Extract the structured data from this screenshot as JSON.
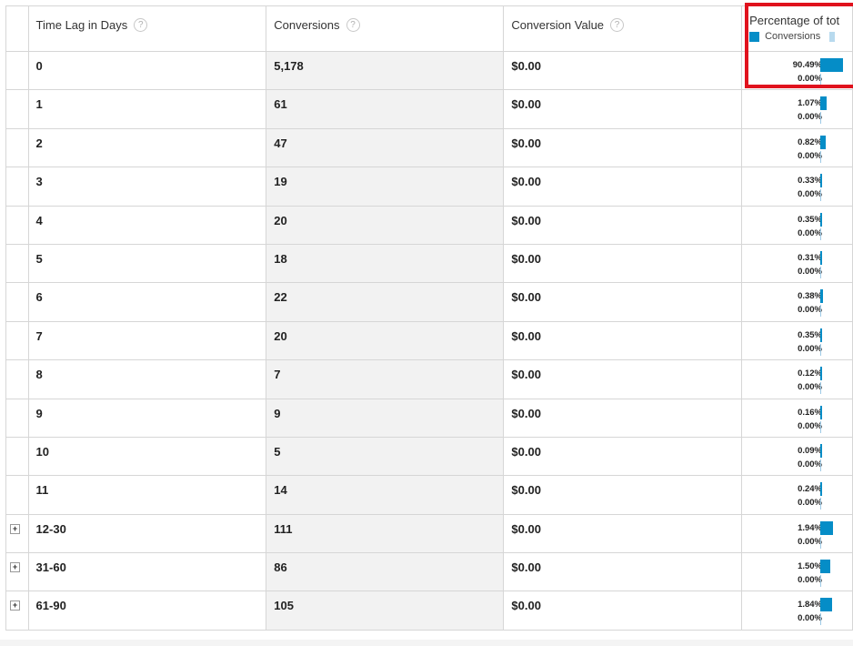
{
  "headers": {
    "time_lag": "Time Lag in Days",
    "conversions": "Conversions",
    "conversion_value": "Conversion Value",
    "percentage": "Percentage of tot",
    "help_glyph": "?"
  },
  "legend": {
    "conversions_label": "Conversions"
  },
  "colors": {
    "bar": "#058dc7",
    "value_bar": "#b8daee",
    "highlight": "#e0121d"
  },
  "rows": [
    {
      "lag": "0",
      "conversions": "5,178",
      "value": "$0.00",
      "pct": "90.49%",
      "pct_value": "0.00%",
      "share": 0.9049,
      "expandable": false
    },
    {
      "lag": "1",
      "conversions": "61",
      "value": "$0.00",
      "pct": "1.07%",
      "pct_value": "0.00%",
      "share": 0.0107,
      "expandable": false
    },
    {
      "lag": "2",
      "conversions": "47",
      "value": "$0.00",
      "pct": "0.82%",
      "pct_value": "0.00%",
      "share": 0.0082,
      "expandable": false
    },
    {
      "lag": "3",
      "conversions": "19",
      "value": "$0.00",
      "pct": "0.33%",
      "pct_value": "0.00%",
      "share": 0.0033,
      "expandable": false
    },
    {
      "lag": "4",
      "conversions": "20",
      "value": "$0.00",
      "pct": "0.35%",
      "pct_value": "0.00%",
      "share": 0.0035,
      "expandable": false
    },
    {
      "lag": "5",
      "conversions": "18",
      "value": "$0.00",
      "pct": "0.31%",
      "pct_value": "0.00%",
      "share": 0.0031,
      "expandable": false
    },
    {
      "lag": "6",
      "conversions": "22",
      "value": "$0.00",
      "pct": "0.38%",
      "pct_value": "0.00%",
      "share": 0.0038,
      "expandable": false
    },
    {
      "lag": "7",
      "conversions": "20",
      "value": "$0.00",
      "pct": "0.35%",
      "pct_value": "0.00%",
      "share": 0.0035,
      "expandable": false
    },
    {
      "lag": "8",
      "conversions": "7",
      "value": "$0.00",
      "pct": "0.12%",
      "pct_value": "0.00%",
      "share": 0.0012,
      "expandable": false
    },
    {
      "lag": "9",
      "conversions": "9",
      "value": "$0.00",
      "pct": "0.16%",
      "pct_value": "0.00%",
      "share": 0.0016,
      "expandable": false
    },
    {
      "lag": "10",
      "conversions": "5",
      "value": "$0.00",
      "pct": "0.09%",
      "pct_value": "0.00%",
      "share": 0.0009,
      "expandable": false
    },
    {
      "lag": "11",
      "conversions": "14",
      "value": "$0.00",
      "pct": "0.24%",
      "pct_value": "0.00%",
      "share": 0.0024,
      "expandable": false
    },
    {
      "lag": "12-30",
      "conversions": "111",
      "value": "$0.00",
      "pct": "1.94%",
      "pct_value": "0.00%",
      "share": 0.0194,
      "expandable": true
    },
    {
      "lag": "31-60",
      "conversions": "86",
      "value": "$0.00",
      "pct": "1.50%",
      "pct_value": "0.00%",
      "share": 0.015,
      "expandable": true
    },
    {
      "lag": "61-90",
      "conversions": "105",
      "value": "$0.00",
      "pct": "1.84%",
      "pct_value": "0.00%",
      "share": 0.0184,
      "expandable": true
    }
  ]
}
